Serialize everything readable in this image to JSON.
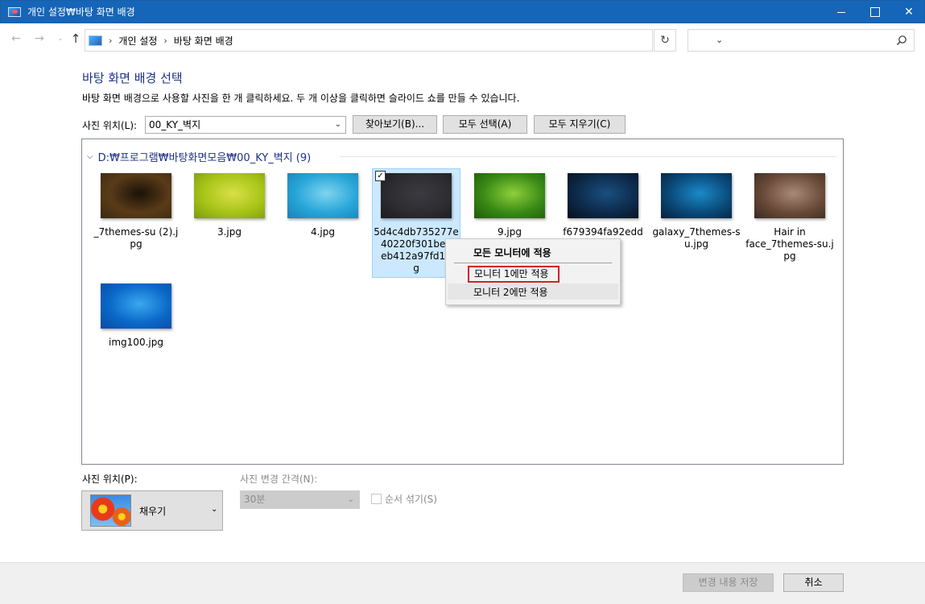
{
  "window": {
    "title": "개인 설정₩바탕 화면 배경",
    "minimize": "",
    "maximize": "",
    "close": "✕"
  },
  "nav": {
    "back": "←",
    "forward": "→",
    "recent": "⌄",
    "up": "↑",
    "breadcrumb": [
      "개인 설정",
      "바탕 화면 배경"
    ],
    "separator": "›",
    "dropdown": "⌄",
    "refresh": "↻",
    "search_placeholder": ""
  },
  "page": {
    "heading": "바탕 화면 배경 선택",
    "description": "바탕 화면 배경으로 사용할 사진을 한 개 클릭하세요. 두 개 이상을 클릭하면 슬라이드 쇼를 만들 수 있습니다.",
    "location_label": "사진 위치(L):",
    "location_value": "00_KY_벽지",
    "browse_button": "찾아보기(B)...",
    "select_all_button": "모두 선택(A)",
    "clear_all_button": "모두 지우기(C)"
  },
  "gallery": {
    "group_title": "D:₩프로그램₩바탕화면모음₩00_KY_벽지 (9)",
    "tiles": [
      {
        "caption": "_7themes-su (2).jpg",
        "selected": false,
        "colors": [
          "#5a3b18",
          "#1a1208",
          "#3a2a10"
        ]
      },
      {
        "caption": "3.jpg",
        "selected": false,
        "colors": [
          "#a8c418",
          "#d8e048",
          "#7a9a10"
        ]
      },
      {
        "caption": "4.jpg",
        "selected": false,
        "colors": [
          "#27a6d8",
          "#7fd4f0",
          "#1d7fb8"
        ]
      },
      {
        "caption": "5d4c4db735277e40220f301beb...eb412a97fd16...g",
        "caption_lines": [
          "5d4c4db735277e",
          "40220f301beb",
          "eb412a97fd16",
          "g"
        ],
        "selected": true,
        "colors": [
          "#2d2d31",
          "#3a3a40",
          "#1c1c20"
        ]
      },
      {
        "caption": "9.jpg",
        "selected": false,
        "colors": [
          "#3a8a16",
          "#8fd03a",
          "#1f5a0a"
        ]
      },
      {
        "caption": "f679394fa92edd...41a2...dc8.j",
        "caption_lines": [
          "f679394fa92edd",
          "41a2",
          "dc8.j"
        ],
        "selected": false,
        "colors": [
          "#0d2a4a",
          "#1a4f80",
          "#05101e"
        ]
      },
      {
        "caption": "galaxy_7themes-su.jpg",
        "caption_lines": [
          "galaxy_7themes-s",
          "u.jpg"
        ],
        "selected": false,
        "colors": [
          "#0a4a7a",
          "#1a8ac8",
          "#06203a"
        ]
      },
      {
        "caption": "Hair in face_7themes-su.jpg",
        "caption_lines": [
          "Hair in",
          "face_7themes-su.j",
          "pg"
        ],
        "selected": false,
        "colors": [
          "#6a4a38",
          "#a88a78",
          "#3a2a20"
        ]
      },
      {
        "caption": "img100.jpg",
        "selected": false,
        "colors": [
          "#0a68c8",
          "#3aa8f0",
          "#0a4aa0"
        ]
      }
    ],
    "checkbox_mark": "✓"
  },
  "context_menu": {
    "items": [
      "모든 모니터에 적용",
      "모니터 1에만 적용",
      "모니터 2에만 적용"
    ]
  },
  "options": {
    "position_label": "사진 위치(P):",
    "position_value": "채우기",
    "interval_label": "사진 변경 간격(N):",
    "interval_value": "30분",
    "shuffle_label": "순서 섞기(S)"
  },
  "footer": {
    "save_button": "변경 내용 저장",
    "cancel_button": "취소"
  }
}
